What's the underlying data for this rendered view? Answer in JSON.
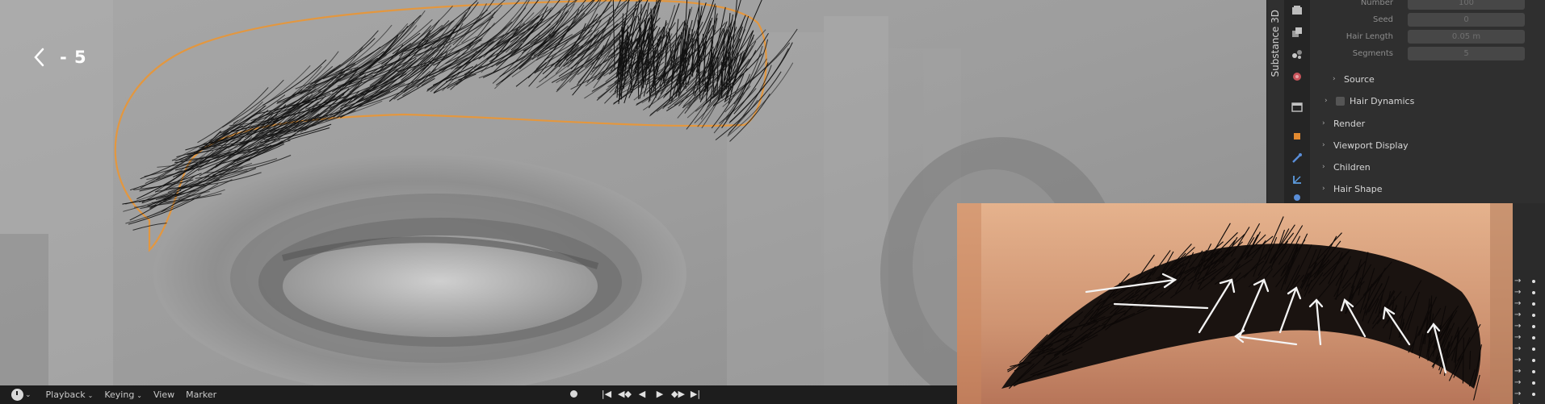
{
  "viewport": {
    "step_indicator": "- 5"
  },
  "timeline": {
    "menus": [
      "Playback",
      "Keying",
      "View",
      "Marker"
    ],
    "controls": [
      "|◀",
      "◀◆",
      "◀",
      "▶",
      "◆▶",
      "▶|"
    ]
  },
  "side_tab": {
    "label": "Substance 3D"
  },
  "properties": {
    "fields": [
      {
        "label": "Number",
        "value": "100"
      },
      {
        "label": "Seed",
        "value": "0"
      },
      {
        "label": "Hair Length",
        "value": "0.05 m"
      },
      {
        "label": "Segments",
        "value": "5"
      }
    ],
    "sections": [
      {
        "label": "Source",
        "indent": true,
        "checkbox": false
      },
      {
        "label": "Hair Dynamics",
        "indent": true,
        "checkbox": true
      },
      {
        "label": "Render",
        "indent": false,
        "checkbox": false
      },
      {
        "label": "Viewport Display",
        "indent": false,
        "checkbox": false
      },
      {
        "label": "Children",
        "indent": false,
        "checkbox": false
      },
      {
        "label": "Hair Shape",
        "indent": false,
        "checkbox": false
      }
    ]
  },
  "colors": {
    "selection_outline": "#e3973f",
    "panel_bg": "#2f2f2f",
    "timeline_bg": "#1d1d1d"
  },
  "icons": [
    "chevron-left-icon",
    "editor-type-icon",
    "record-icon",
    "tool-icon",
    "render-icon",
    "output-icon",
    "view-layer-icon",
    "scene-icon",
    "world-icon",
    "object-icon",
    "modifier-icon",
    "particles-icon",
    "physics-icon"
  ]
}
